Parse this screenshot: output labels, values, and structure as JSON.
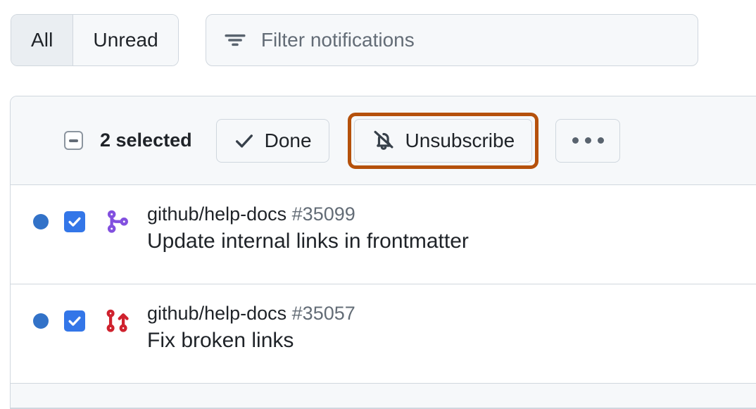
{
  "tabs": {
    "all_label": "All",
    "unread_label": "Unread",
    "selected": "All"
  },
  "search": {
    "placeholder": "Filter notifications",
    "value": "",
    "icon": "filter-icon"
  },
  "toolbar": {
    "select_all_state": "indeterminate",
    "selected_count_label": "2 selected",
    "done_label": "Done",
    "done_icon": "check-icon",
    "unsubscribe_label": "Unsubscribe",
    "unsubscribe_icon": "bell-slash-icon",
    "unsubscribe_highlighted": true,
    "highlight_color": "#b5510b",
    "overflow_icon": "kebab-horizontal-icon"
  },
  "colors": {
    "unread_dot": "#3272c8",
    "checkbox": "#3376e8",
    "merged_pr": "#8250df",
    "closed_pr": "#cf222e",
    "border": "#d0d7de",
    "header_bg": "#f6f8fa",
    "text": "#1f2328",
    "muted_text": "#636c76"
  },
  "notifications": [
    {
      "unread": true,
      "checked": true,
      "icon": "git-merge-icon",
      "icon_color": "#8250df",
      "repo": "github/help-docs",
      "number": "#35099",
      "title": "Update internal links in frontmatter"
    },
    {
      "unread": true,
      "checked": true,
      "icon": "git-pull-request-closed-icon",
      "icon_color": "#cf222e",
      "repo": "github/help-docs",
      "number": "#35057",
      "title": "Fix broken links"
    }
  ]
}
